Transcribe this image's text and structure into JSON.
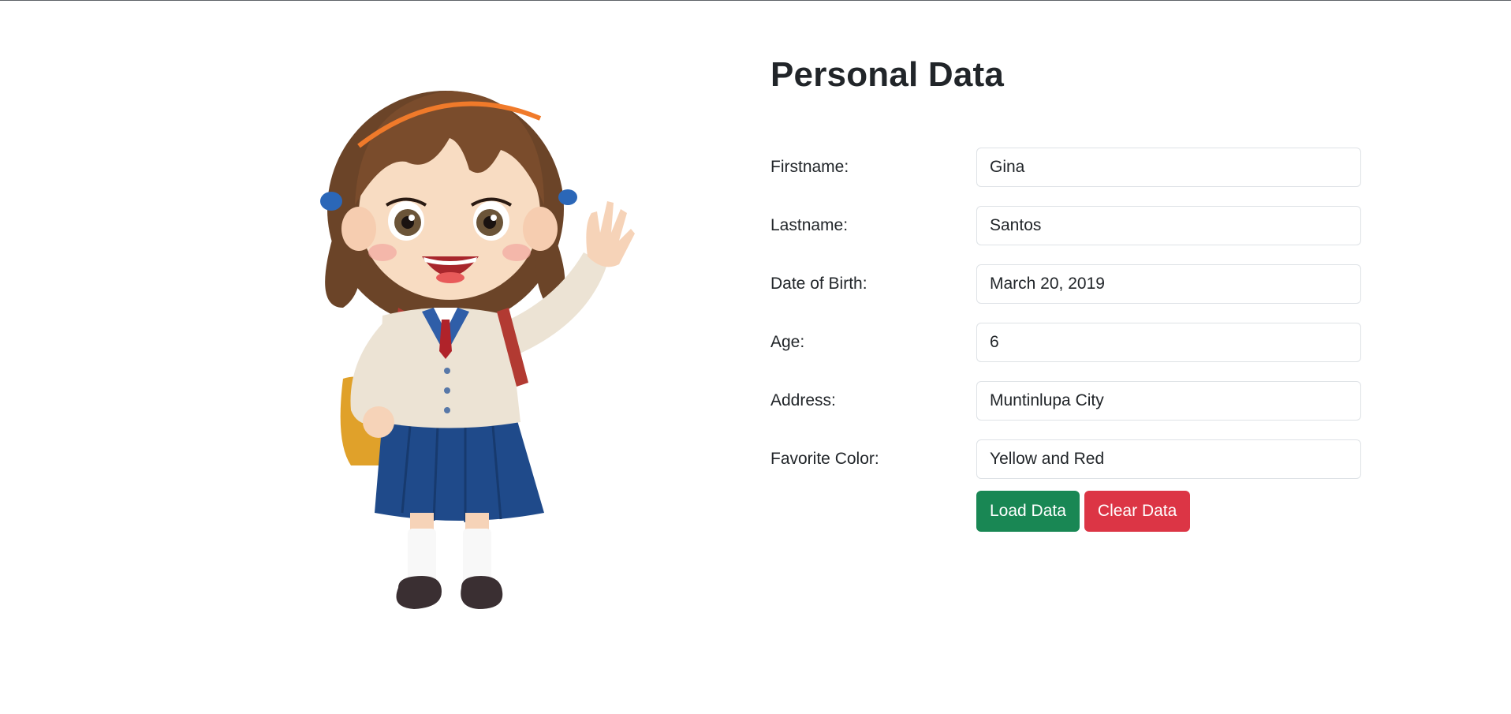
{
  "page": {
    "title": "Personal Data"
  },
  "form": {
    "fields": [
      {
        "label": "Firstname:",
        "value": "Gina"
      },
      {
        "label": "Lastname:",
        "value": "Santos"
      },
      {
        "label": "Date of Birth:",
        "value": "March 20, 2019"
      },
      {
        "label": "Age:",
        "value": "6"
      },
      {
        "label": "Address:",
        "value": "Muntinlupa City"
      },
      {
        "label": "Favorite Color:",
        "value": "Yellow and Red"
      }
    ]
  },
  "buttons": {
    "load_label": "Load Data",
    "clear_label": "Clear Data"
  },
  "colors": {
    "load": "#198754",
    "clear": "#dc3545"
  }
}
